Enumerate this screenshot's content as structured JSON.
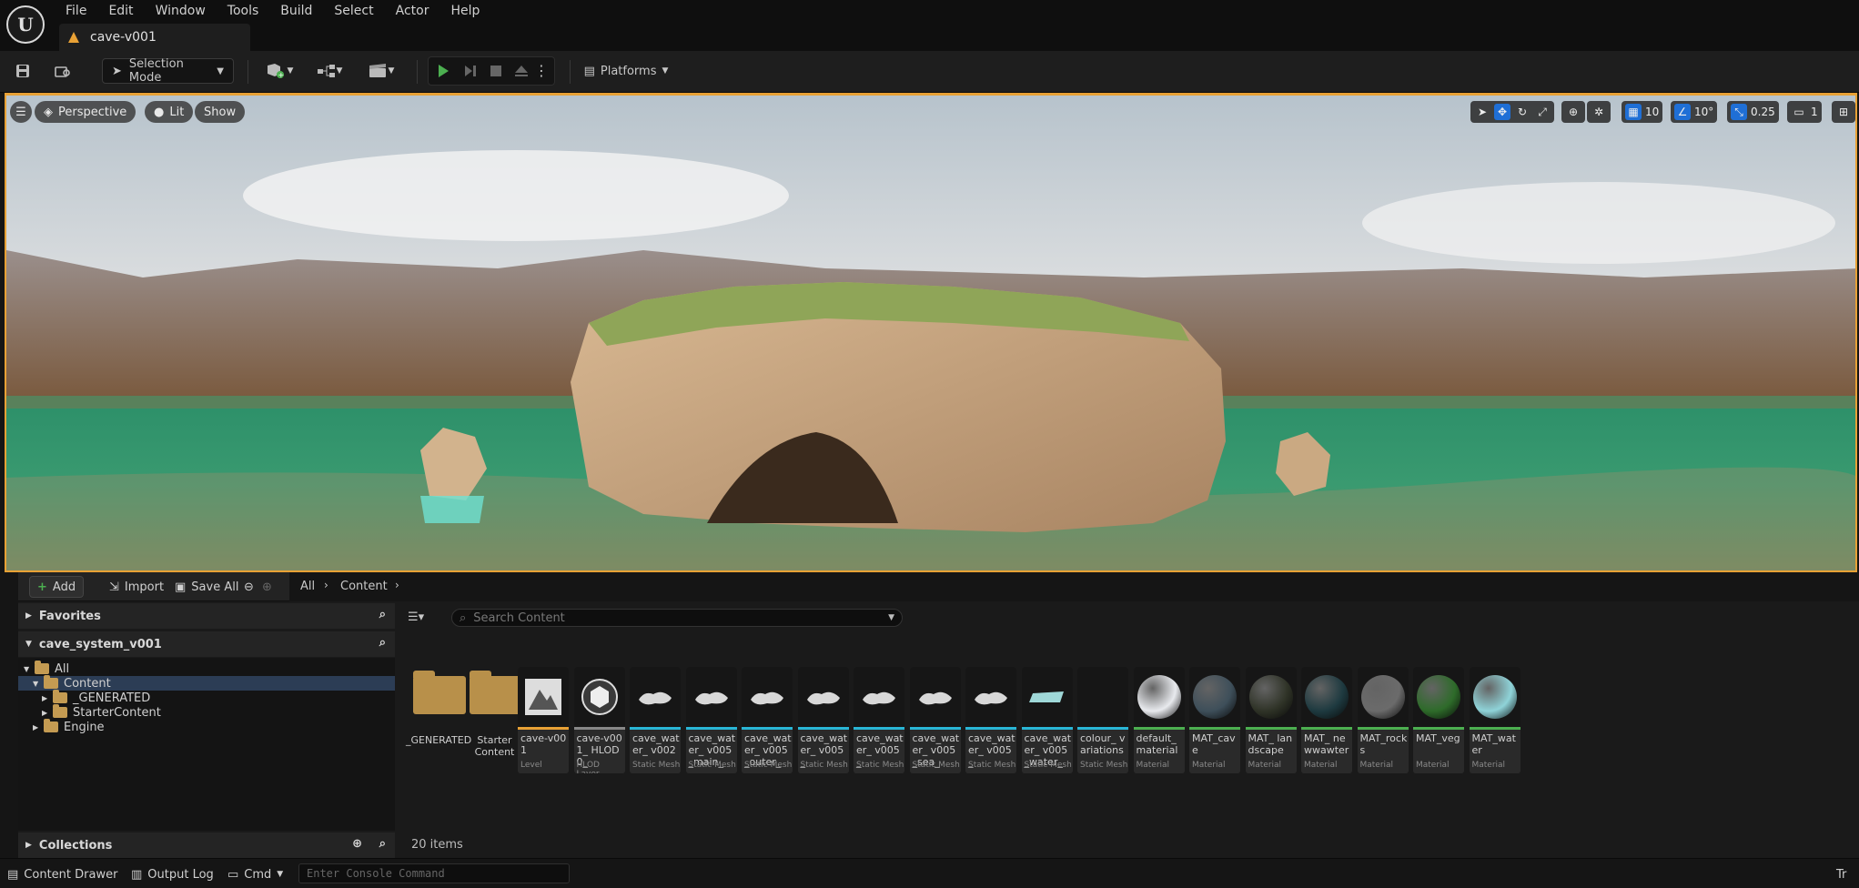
{
  "menu": [
    "File",
    "Edit",
    "Window",
    "Tools",
    "Build",
    "Select",
    "Actor",
    "Help"
  ],
  "document_tab": {
    "title": "cave-v001"
  },
  "toolbar": {
    "mode_label": "Selection Mode",
    "platforms_label": "Platforms"
  },
  "viewport": {
    "perspective_label": "Perspective",
    "lit_label": "Lit",
    "show_label": "Show",
    "grid_snap": "10",
    "rotation_snap": "10°",
    "scale_snap": "0.25",
    "camera_speed": "1"
  },
  "content_browser": {
    "add_label": "Add",
    "import_label": "Import",
    "save_all_label": "Save All",
    "breadcrumb": [
      "All",
      "Content"
    ],
    "favorites_label": "Favorites",
    "project_label": "cave_system_v001",
    "tree": [
      {
        "label": "All",
        "indent": 0,
        "expanded": true,
        "selected": false
      },
      {
        "label": "Content",
        "indent": 1,
        "expanded": true,
        "selected": true
      },
      {
        "label": "_GENERATED",
        "indent": 2,
        "expanded": false,
        "selected": false
      },
      {
        "label": "StarterContent",
        "indent": 2,
        "expanded": false,
        "selected": false
      },
      {
        "label": "Engine",
        "indent": 1,
        "expanded": false,
        "selected": false
      }
    ],
    "collections_label": "Collections",
    "search_placeholder": "Search Content",
    "item_count": "20 items",
    "folders": [
      {
        "name": "_GENERATED"
      },
      {
        "name": "Starter Content"
      }
    ],
    "assets": [
      {
        "name": "cave-v001",
        "type": "Level",
        "color": "#e8a135",
        "thumb": "level"
      },
      {
        "name": "cave-v001_ HLOD0_",
        "type": "HLOD Layer",
        "color": "#888888",
        "thumb": "hlod"
      },
      {
        "name": "cave_water_ v002",
        "type": "Static Mesh",
        "color": "#29b6d6",
        "thumb": "mesh"
      },
      {
        "name": "cave_water_ v005_main_",
        "type": "Static Mesh",
        "color": "#29b6d6",
        "thumb": "mesh"
      },
      {
        "name": "cave_water_ v005_outer_",
        "type": "Static Mesh",
        "color": "#29b6d6",
        "thumb": "mesh"
      },
      {
        "name": "cave_water_ v005_",
        "type": "Static Mesh",
        "color": "#29b6d6",
        "thumb": "mesh"
      },
      {
        "name": "cave_water_ v005_",
        "type": "Static Mesh",
        "color": "#29b6d6",
        "thumb": "mesh"
      },
      {
        "name": "cave_water_ v005_sea_",
        "type": "Static Mesh",
        "color": "#29b6d6",
        "thumb": "mesh"
      },
      {
        "name": "cave_water_ v005_",
        "type": "Static Mesh",
        "color": "#29b6d6",
        "thumb": "mesh"
      },
      {
        "name": "cave_water_ v005_water_",
        "type": "Static Mesh",
        "color": "#29b6d6",
        "thumb": "plane"
      },
      {
        "name": "colour_ variations",
        "type": "Static Mesh",
        "color": "#29b6d6",
        "thumb": "empty"
      },
      {
        "name": "default_ material",
        "type": "Material",
        "color": "#4caf50",
        "thumb": "sphere",
        "sphere": "#e8eaee"
      },
      {
        "name": "MAT_cave",
        "type": "Material",
        "color": "#4caf50",
        "thumb": "sphere",
        "sphere": "#3e4f5a"
      },
      {
        "name": "MAT_ landscape",
        "type": "Material",
        "color": "#4caf50",
        "thumb": "sphere",
        "sphere": "#2f3327"
      },
      {
        "name": "MAT_ newwawter",
        "type": "Material",
        "color": "#4caf50",
        "thumb": "sphere",
        "sphere": "#1e3a40"
      },
      {
        "name": "MAT_rocks",
        "type": "Material",
        "color": "#4caf50",
        "thumb": "sphere",
        "sphere": "#6b6b6b"
      },
      {
        "name": "MAT_veg",
        "type": "Material",
        "color": "#4caf50",
        "thumb": "sphere",
        "sphere": "#2e6b2a"
      },
      {
        "name": "MAT_water",
        "type": "Material",
        "color": "#4caf50",
        "thumb": "sphere",
        "sphere": "#8fd3d8"
      }
    ]
  },
  "statusbar": {
    "content_drawer_label": "Content Drawer",
    "output_log_label": "Output Log",
    "cmd_label": "Cmd",
    "console_placeholder": "Enter Console Command",
    "trace_label": "Tr"
  },
  "colors": {
    "accent_orange": "#e8a135",
    "selection_blue": "#1f6fd6",
    "play_green": "#4caf50"
  }
}
